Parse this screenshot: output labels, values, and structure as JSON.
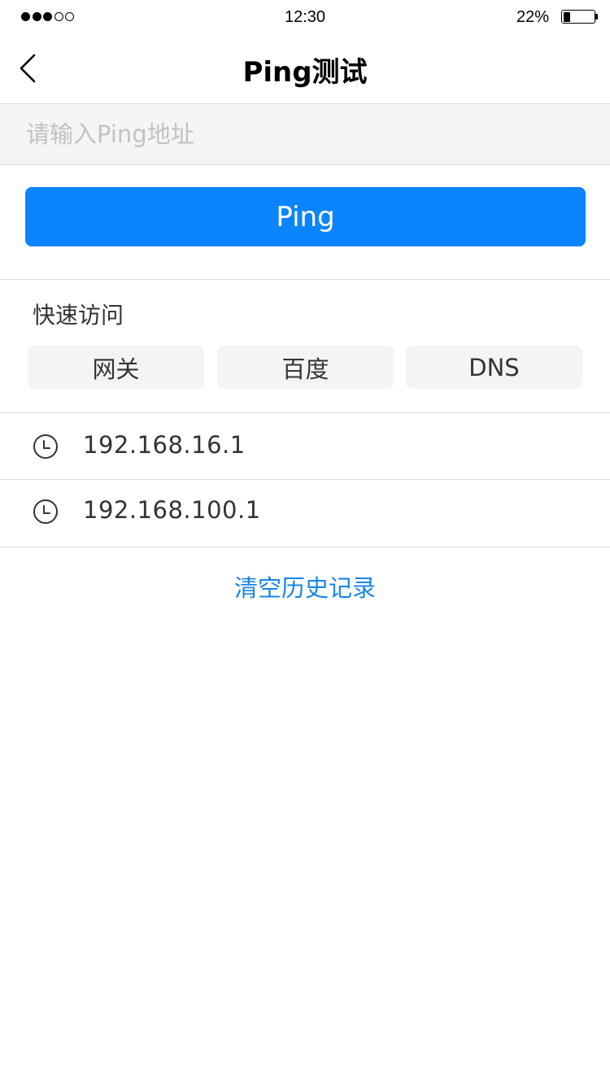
{
  "status_bar": {
    "signal_dots_filled": 3,
    "signal_dots_total": 5,
    "time": "12:30",
    "battery_percent_text": "22%",
    "battery_level": 0.22
  },
  "nav": {
    "back_icon": "chevron-left-icon",
    "title": "Ping测试"
  },
  "search": {
    "placeholder": "请输入Ping地址",
    "value": ""
  },
  "ping_button": {
    "label": "Ping",
    "color": "#0a84ff"
  },
  "quick_access": {
    "title": "快速访问",
    "items": [
      {
        "label": "网关"
      },
      {
        "label": "百度"
      },
      {
        "label": "DNS"
      }
    ]
  },
  "history": {
    "icon": "clock-icon",
    "items": [
      {
        "address": "192.168.16.1"
      },
      {
        "address": "192.168.100.1"
      }
    ],
    "clear_label": "清空历史记录",
    "clear_color": "#1a85e6"
  }
}
